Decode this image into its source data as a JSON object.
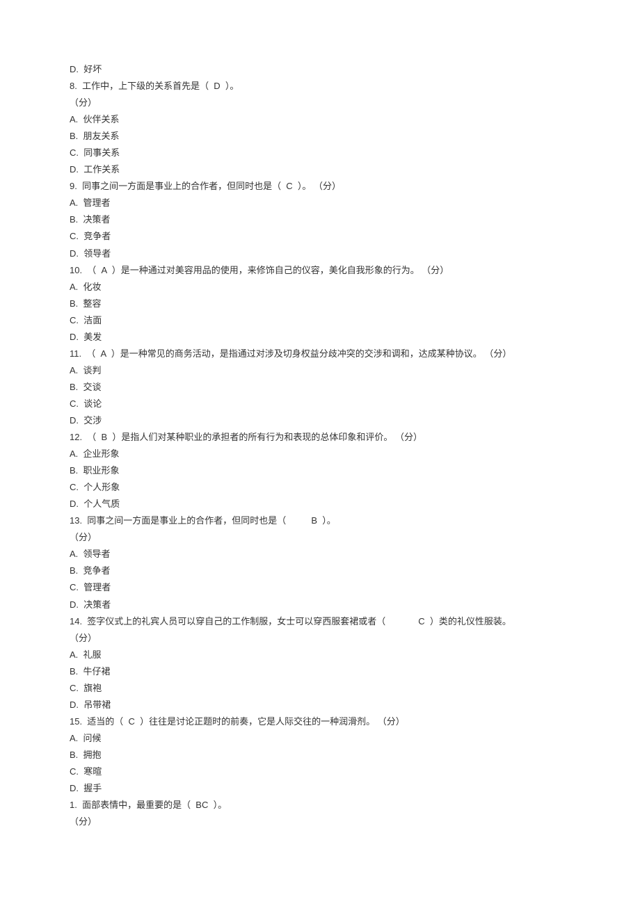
{
  "lines": [
    "D.  好坏",
    "8.  工作中，上下级的关系首先是（  D  ）。",
    "（分）",
    "A.  伙伴关系",
    "B.  朋友关系",
    "C.  同事关系",
    "D.  工作关系",
    "9.  同事之间一方面是事业上的合作者，但同时也是（  C  ）。 （分）",
    "A.  管理者",
    "B.  决策者",
    "C.  竞争者",
    "D.  领导者",
    "10.  （  A  ）是一种通过对美容用品的使用，来修饰自己的仪容，美化自我形象的行为。 （分）",
    "A.  化妆",
    "B.  整容",
    "C.  洁面",
    "D.  美发",
    "11.  （  A  ）是一种常见的商务活动，是指通过对涉及切身权益分歧冲突的交涉和调和，达成某种协议。 （分）",
    "A.  谈判",
    "B.  交谈",
    "C.  谈论",
    "D.  交涉",
    "12.  （  B  ）是指人们对某种职业的承担者的所有行为和表现的总体印象和评价。 （分）",
    "A.  企业形象",
    "B.  职业形象",
    "C.  个人形象",
    "D.  个人气质",
    "13.  同事之间一方面是事业上的合作者，但同时也是（          B  ）。",
    "（分）",
    "A.  领导者",
    "B.  竞争者",
    "C.  管理者",
    "D.  决策者",
    "14.  签字仪式上的礼宾人员可以穿自己的工作制服，女士可以穿西服套裙或者（             C  ）类的礼仪性服装。",
    "（分）",
    "A.  礼服",
    "B.  牛仔裙",
    "C.  旗袍",
    "D.  吊带裙",
    "15.  适当的（  C  ）往往是讨论正题时的前奏，它是人际交往的一种润滑剂。 （分）",
    "A.  问候",
    "B.  拥抱",
    "C.  寒暄",
    "D.  握手",
    "1.  面部表情中，最重要的是（  BC  ）。",
    "（分）"
  ]
}
